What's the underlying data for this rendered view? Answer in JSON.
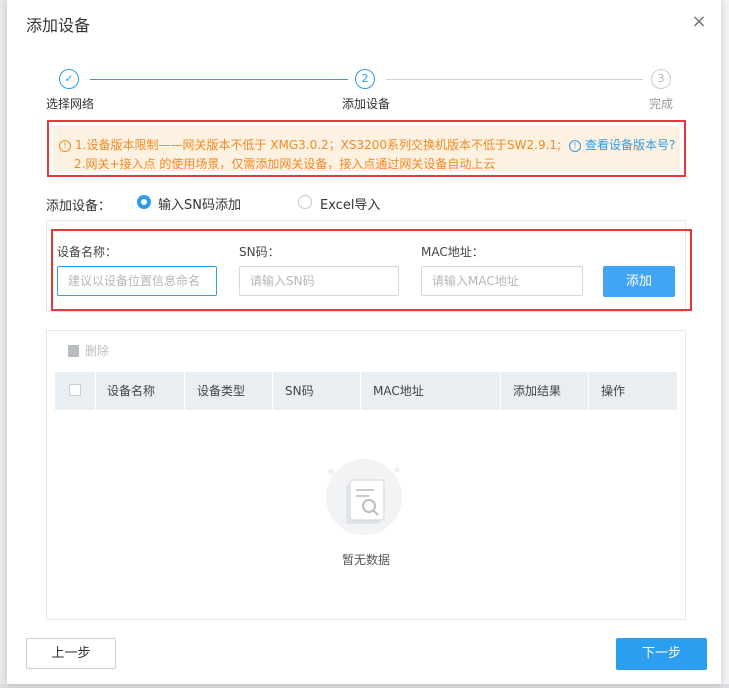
{
  "dialog": {
    "title": "添加设备",
    "close_glyph": "×"
  },
  "steps": [
    {
      "number": "✓",
      "label": "选择网络",
      "state": "done"
    },
    {
      "number": "2",
      "label": "添加设备",
      "state": "active"
    },
    {
      "number": "3",
      "label": "完成",
      "state": "future"
    }
  ],
  "notice": {
    "line1": "1.设备版本限制——网关版本不低于 XMG3.0.2；XS3200系列交换机版本不低于SW2.9.1;",
    "link": "查看设备版本号?",
    "line2": "2.网关+接入点 的使用场景，仅需添加网关设备，接入点通过网关设备自动上云",
    "icon": "info-circle-icon"
  },
  "add_mode": {
    "label": "添加设备：",
    "options": [
      {
        "label": "输入SN码添加",
        "checked": true
      },
      {
        "label": "Excel导入",
        "checked": false
      }
    ]
  },
  "form": {
    "name_label": "设备名称：",
    "name_placeholder": "建议以设备位置信息命名",
    "name_value": "",
    "sn_label": "SN码：",
    "sn_placeholder": "请输入SN码",
    "sn_value": "",
    "mac_label": "MAC地址：",
    "mac_placeholder": "请输入MAC地址",
    "mac_value": "",
    "add_button": "添加"
  },
  "table": {
    "delete_label": "删除",
    "columns": [
      "设备名称",
      "设备类型",
      "SN码",
      "MAC地址",
      "添加结果",
      "操作"
    ],
    "rows": [],
    "empty_text": "暂无数据"
  },
  "footer": {
    "prev": "上一步",
    "next": "下一步"
  },
  "colors": {
    "accent": "#2e9ce6",
    "warning_text": "#f08a24",
    "highlight_border": "#e53a3a"
  }
}
